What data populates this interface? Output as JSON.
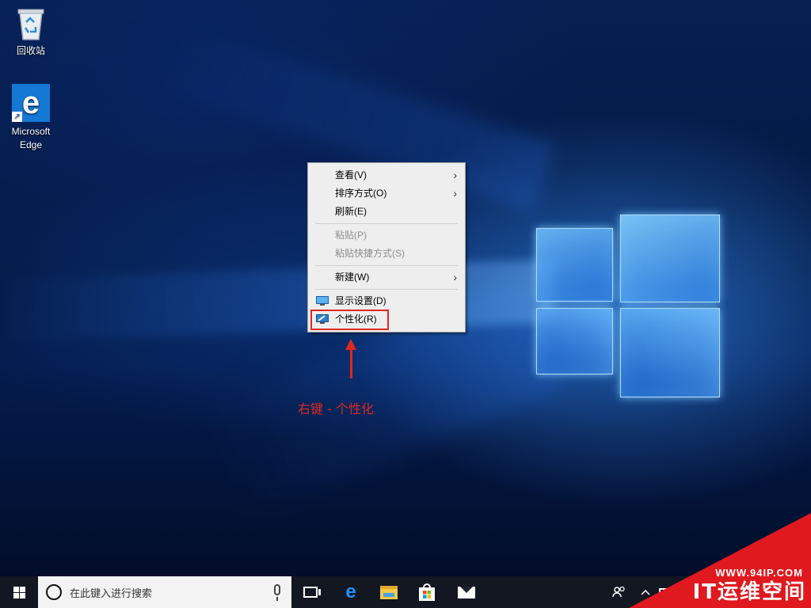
{
  "desktop": {
    "icons": [
      {
        "label": "回收站",
        "icon": "recycle-bin-icon"
      },
      {
        "label_line1": "Microsoft",
        "label_line2": "Edge",
        "icon": "edge-icon"
      }
    ]
  },
  "context_menu": {
    "items": [
      {
        "label": "查看(V)",
        "submenu": true,
        "enabled": true
      },
      {
        "label": "排序方式(O)",
        "submenu": true,
        "enabled": true
      },
      {
        "label": "刷新(E)",
        "submenu": false,
        "enabled": true
      },
      {
        "label": "粘贴(P)",
        "submenu": false,
        "enabled": false
      },
      {
        "label": "粘贴快捷方式(S)",
        "submenu": false,
        "enabled": false
      },
      {
        "label": "新建(W)",
        "submenu": true,
        "enabled": true
      },
      {
        "label": "显示设置(D)",
        "icon": "display-settings-icon",
        "enabled": true
      },
      {
        "label": "个性化(R)",
        "icon": "personalize-icon",
        "enabled": true,
        "highlighted": true
      }
    ],
    "arrow_glyph": "›"
  },
  "annotation": {
    "text": "右键 - 个性化",
    "color": "#e0281e"
  },
  "taskbar": {
    "search_placeholder": "在此键入进行搜索",
    "pinned": [
      "task-view-icon",
      "edge-icon",
      "file-explorer-icon",
      "store-icon",
      "mail-icon"
    ],
    "tray": [
      "people-icon",
      "chevron-up-icon",
      "network-icon"
    ]
  },
  "watermark": {
    "url": "WWW.94IP.COM",
    "name": "IT运维空间",
    "color": "#e0191f"
  }
}
